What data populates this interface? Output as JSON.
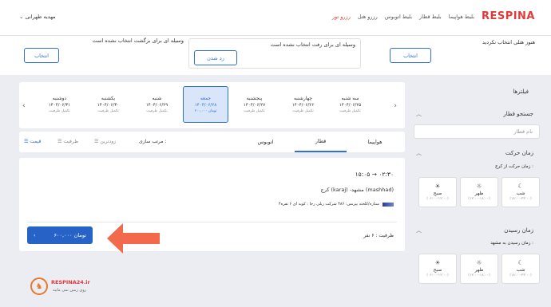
{
  "header": {
    "brand": "RESPINA",
    "nav": [
      "بلیط هواپیما",
      "بلیط قطار",
      "بلیط اتوبوس",
      "رزرو هتل",
      "رزرو تور"
    ],
    "active_index": 4,
    "user": "مهدیه طهرانی"
  },
  "summary": {
    "hotel_text": "هنوز هتلی انتخاب نکردید",
    "hotel_button": "انتخاب",
    "outbound_text": "وسیله ای برای رفت انتخاب نشده است",
    "outbound_button": "رد شدن",
    "return_text": "وسیله ای برای برگشت انتخاب نشده است",
    "return_button": "انتخاب"
  },
  "filters": {
    "title": "فیلترها",
    "search_title": "جستجو قطار",
    "search_placeholder": "نام قطار",
    "departure_title": "زمان حرکت",
    "departure_sub": "زمان حرکت از کرج :",
    "arrival_title": "زمان رسیدن",
    "arrival_sub": "زمان رسیدن به مشهد :",
    "times": [
      {
        "name": "شب",
        "range": "(۱۸:۰۰-۲۴:۰۰)",
        "icon": "moon-icon"
      },
      {
        "name": "ظهر",
        "range": "(۱۲:۰۰-۱۸:۰۰)",
        "icon": "sun-icon"
      },
      {
        "name": "صبح",
        "range": "(۰۶:۰۰-۱۲:۰۰)",
        "icon": "sunrise-icon"
      }
    ]
  },
  "dates": [
    {
      "day": "سه شنبه",
      "date": "۱۴۰۴/۰۶/۲۵",
      "price": "تکمیل ظرفیت"
    },
    {
      "day": "چهارشنبه",
      "date": "۱۴۰۴/۰۶/۲۶",
      "price": "تکمیل ظرفیت"
    },
    {
      "day": "پنجشنبه",
      "date": "۱۴۰۴/۰۶/۲۷",
      "price": "تکمیل ظرفیت"
    },
    {
      "day": "جمعه",
      "date": "۱۴۰۴/۰۶/۲۸",
      "price": "۶۰۰,۰۰۰ تومان"
    },
    {
      "day": "شنبه",
      "date": "۱۴۰۴/۰۶/۲۹",
      "price": "تکمیل ظرفیت"
    },
    {
      "day": "یکشنبه",
      "date": "۱۴۰۴/۰۶/۳۰",
      "price": "تکمیل ظرفیت"
    },
    {
      "day": "دوشنبه",
      "date": "۱۴۰۴/۰۶/۳۱",
      "price": "تکمیل ظرفیت"
    }
  ],
  "selected_date_index": 3,
  "tabs": [
    "هواپیما",
    "قطار",
    "اتوبوس"
  ],
  "active_tab": 1,
  "sort": {
    "label": "مرتب سازی :",
    "options": [
      "زودترین",
      "ظرفیت",
      "قیمت"
    ],
    "active": 2
  },
  "result": {
    "times": "۱۵:۰۵ → ۰۲:۳۰",
    "route": "کرج (karaj) -مشهد (mashhad)",
    "details": "۴ستاره/کلخته بیزنس: ۴۸۶  شرکت ریلی رجا : کوپه ای ۶ نفره",
    "capacity": "ظرفیت : ۶ نفر",
    "price": "۶۰۰,۰۰۰ تومان"
  },
  "footer": {
    "logo": "RESPINA24.ir",
    "tagline": "روی زمین نمی مانید"
  },
  "colors": {
    "brand": "#e23a3a",
    "accent": "#2e6fd9",
    "price_button": "#2762c6",
    "arrow": "#f26a4b"
  }
}
